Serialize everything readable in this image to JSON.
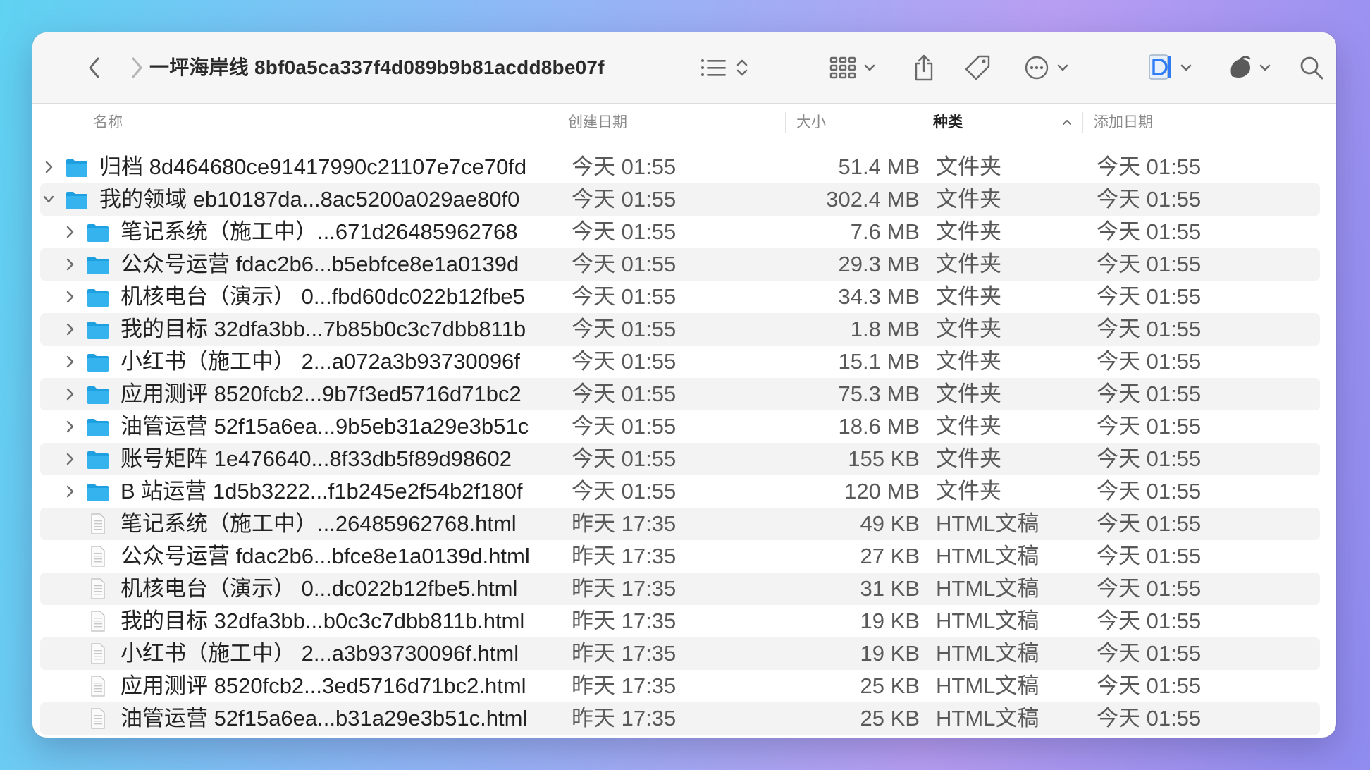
{
  "window": {
    "title": "一坪海岸线 8bf0a5ca337f4d089b9b81acdd8be07f"
  },
  "toolbar": {
    "icons": [
      "back-icon",
      "forward-icon",
      "list-view-icon",
      "sort-stepper-icon",
      "grid-view-icon",
      "share-icon",
      "tag-icon",
      "more-icon",
      "app-icon",
      "app-icon-2",
      "search-icon"
    ]
  },
  "columns": {
    "name": "名称",
    "created": "创建日期",
    "size": "大小",
    "kind": "种类",
    "added": "添加日期"
  },
  "colors": {
    "folder": "#35b3ee",
    "row_alt": "#f3f3f3",
    "accent": "#2f7cf6"
  },
  "rows": [
    {
      "indent": 0,
      "expand": "collapsed",
      "type": "folder",
      "name": "归档 8d464680ce91417990c21107e7ce70fd",
      "created": "今天 01:55",
      "size": "51.4 MB",
      "kind": "文件夹",
      "added": "今天 01:55"
    },
    {
      "indent": 0,
      "expand": "expanded",
      "type": "folder",
      "name": "我的领域 eb10187da...8ac5200a029ae80f0",
      "created": "今天 01:55",
      "size": "302.4 MB",
      "kind": "文件夹",
      "added": "今天 01:55"
    },
    {
      "indent": 1,
      "expand": "collapsed",
      "type": "folder",
      "name": "笔记系统（施工中）...671d26485962768",
      "created": "今天 01:55",
      "size": "7.6 MB",
      "kind": "文件夹",
      "added": "今天 01:55"
    },
    {
      "indent": 1,
      "expand": "collapsed",
      "type": "folder",
      "name": "公众号运营 fdac2b6...b5ebfce8e1a0139d",
      "created": "今天 01:55",
      "size": "29.3 MB",
      "kind": "文件夹",
      "added": "今天 01:55"
    },
    {
      "indent": 1,
      "expand": "collapsed",
      "type": "folder",
      "name": "机核电台（演示） 0...fbd60dc022b12fbe5",
      "created": "今天 01:55",
      "size": "34.3 MB",
      "kind": "文件夹",
      "added": "今天 01:55"
    },
    {
      "indent": 1,
      "expand": "collapsed",
      "type": "folder",
      "name": "我的目标 32dfa3bb...7b85b0c3c7dbb811b",
      "created": "今天 01:55",
      "size": "1.8 MB",
      "kind": "文件夹",
      "added": "今天 01:55"
    },
    {
      "indent": 1,
      "expand": "collapsed",
      "type": "folder",
      "name": "小红书（施工中） 2...a072a3b93730096f",
      "created": "今天 01:55",
      "size": "15.1 MB",
      "kind": "文件夹",
      "added": "今天 01:55"
    },
    {
      "indent": 1,
      "expand": "collapsed",
      "type": "folder",
      "name": "应用测评 8520fcb2...9b7f3ed5716d71bc2",
      "created": "今天 01:55",
      "size": "75.3 MB",
      "kind": "文件夹",
      "added": "今天 01:55"
    },
    {
      "indent": 1,
      "expand": "collapsed",
      "type": "folder",
      "name": "油管运营 52f15a6ea...9b5eb31a29e3b51c",
      "created": "今天 01:55",
      "size": "18.6 MB",
      "kind": "文件夹",
      "added": "今天 01:55"
    },
    {
      "indent": 1,
      "expand": "collapsed",
      "type": "folder",
      "name": "账号矩阵 1e476640...8f33db5f89d98602",
      "created": "今天 01:55",
      "size": "155 KB",
      "kind": "文件夹",
      "added": "今天 01:55"
    },
    {
      "indent": 1,
      "expand": "collapsed",
      "type": "folder",
      "name": "B 站运营 1d5b3222...f1b245e2f54b2f180f",
      "created": "今天 01:55",
      "size": "120 MB",
      "kind": "文件夹",
      "added": "今天 01:55"
    },
    {
      "indent": 1,
      "expand": "none",
      "type": "file",
      "name": "笔记系统（施工中）...26485962768.html",
      "created": "昨天 17:35",
      "size": "49 KB",
      "kind": "HTML文稿",
      "added": "今天 01:55"
    },
    {
      "indent": 1,
      "expand": "none",
      "type": "file",
      "name": "公众号运营 fdac2b6...bfce8e1a0139d.html",
      "created": "昨天 17:35",
      "size": "27 KB",
      "kind": "HTML文稿",
      "added": "今天 01:55"
    },
    {
      "indent": 1,
      "expand": "none",
      "type": "file",
      "name": "机核电台（演示） 0...dc022b12fbe5.html",
      "created": "昨天 17:35",
      "size": "31 KB",
      "kind": "HTML文稿",
      "added": "今天 01:55"
    },
    {
      "indent": 1,
      "expand": "none",
      "type": "file",
      "name": "我的目标 32dfa3bb...b0c3c7dbb811b.html",
      "created": "昨天 17:35",
      "size": "19 KB",
      "kind": "HTML文稿",
      "added": "今天 01:55"
    },
    {
      "indent": 1,
      "expand": "none",
      "type": "file",
      "name": "小红书（施工中） 2...a3b93730096f.html",
      "created": "昨天 17:35",
      "size": "19 KB",
      "kind": "HTML文稿",
      "added": "今天 01:55"
    },
    {
      "indent": 1,
      "expand": "none",
      "type": "file",
      "name": "应用测评 8520fcb2...3ed5716d71bc2.html",
      "created": "昨天 17:35",
      "size": "25 KB",
      "kind": "HTML文稿",
      "added": "今天 01:55"
    },
    {
      "indent": 1,
      "expand": "none",
      "type": "file",
      "name": "油管运营 52f15a6ea...b31a29e3b51c.html",
      "created": "昨天 17:35",
      "size": "25 KB",
      "kind": "HTML文稿",
      "added": "今天 01:55"
    }
  ]
}
